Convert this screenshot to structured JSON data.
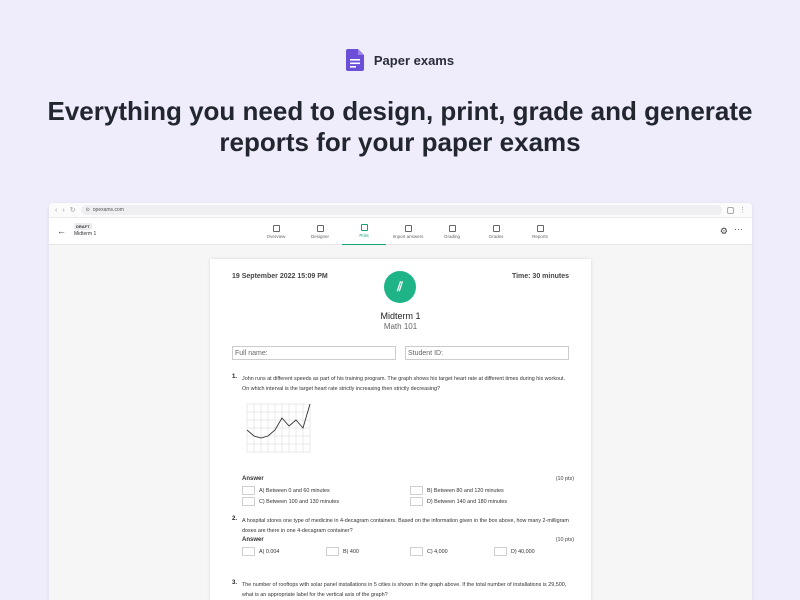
{
  "marketing": {
    "product_name": "Paper exams",
    "headline_line1": "Everything you need to design, print, grade and generate",
    "headline_line2": "reports for your paper exams"
  },
  "browser": {
    "url": "opexams.com"
  },
  "appbar": {
    "status_badge": "DRAFT",
    "exam_title": "Midterm 1",
    "tabs": [
      {
        "label": "Overview",
        "icon": "overview-icon"
      },
      {
        "label": "Designer",
        "icon": "designer-icon"
      },
      {
        "label": "Print",
        "icon": "print-icon",
        "active": true
      },
      {
        "label": "Import answers",
        "icon": "import-icon"
      },
      {
        "label": "Grading",
        "icon": "grading-icon"
      },
      {
        "label": "Grades",
        "icon": "grades-icon"
      },
      {
        "label": "Reports",
        "icon": "reports-icon"
      }
    ]
  },
  "paper": {
    "date": "19 September 2022 15:09 PM",
    "time_limit": "Time: 30 minutes",
    "title": "Midterm 1",
    "subject": "Math 101",
    "full_name_placeholder": "Full name:",
    "student_id_placeholder": "Student ID:",
    "answer_label": "Answer",
    "questions": [
      {
        "number": "1.",
        "text": "John runs at different speeds as part of his training program. The graph shows his target heart rate at different times during his workout. On which interval is the target heart rate strictly increasing then strictly decreasing?",
        "points": "(10 pts)",
        "options": [
          "A) Between 0 and 60 minutes",
          "B) Between 80 and 120 minutes",
          "C) Between 100 and 130 minutes",
          "D) Between 140 and 180 minutes"
        ]
      },
      {
        "number": "2.",
        "text": "A hospital stores one type of medicine in 4-decagram containers. Based on the information given in the box above, how many 2-milligram doses are there in one 4-decagram container?",
        "points": "(10 pts)",
        "options": [
          "A) 0.004",
          "B) 400",
          "C) 4,000",
          "D) 40,000"
        ]
      },
      {
        "number": "3.",
        "text": "The number of rooftops with solar panel installations in 5 cities is shown in the graph above. If the total number of installations is 29,500, what is an appropriate label for the vertical axis of the graph?"
      }
    ]
  },
  "colors": {
    "accent": "#12a37a",
    "brand": "#6b4fd8",
    "background": "#efedfb"
  }
}
